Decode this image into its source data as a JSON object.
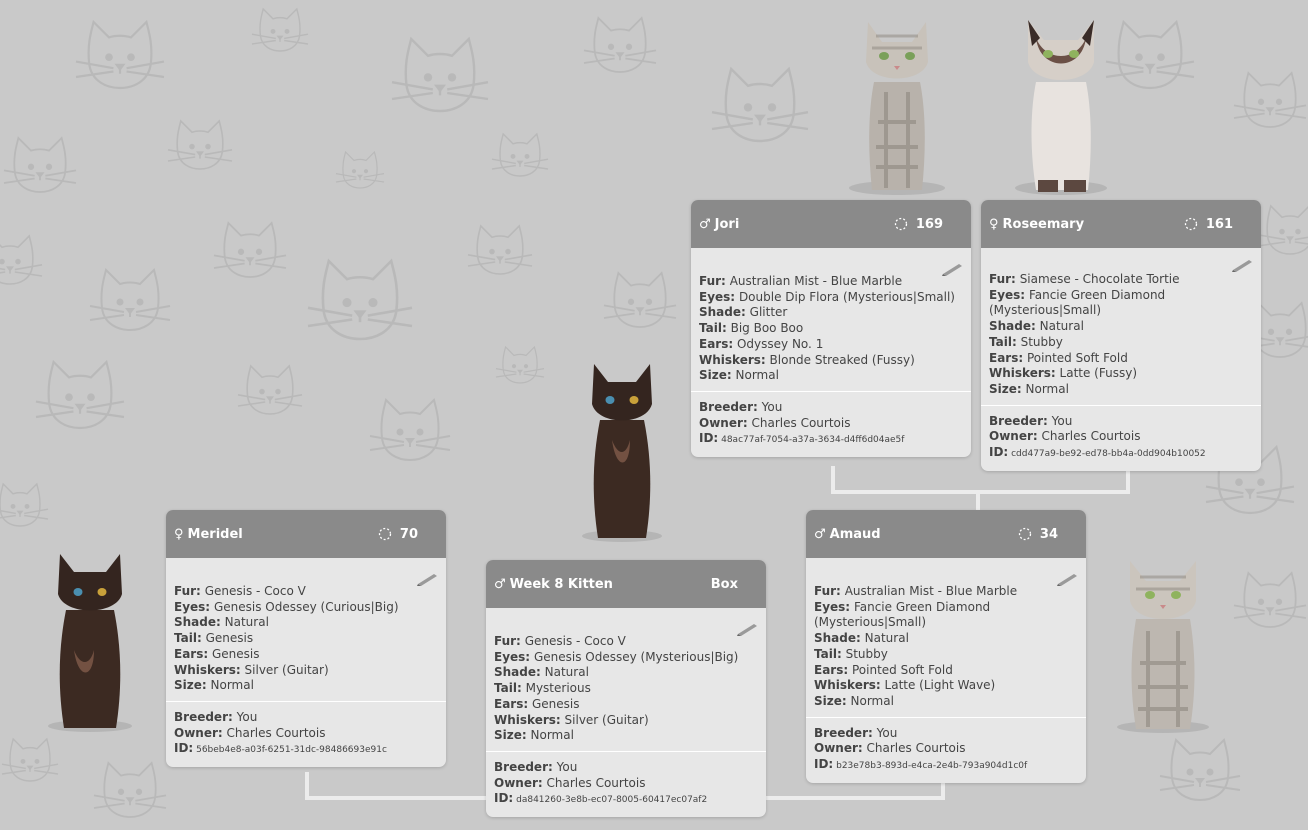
{
  "colors": {
    "background": "#c9c9c9",
    "header": "#8a8a8a",
    "card": "#e7e7e7",
    "connector": "#ececec"
  },
  "icons": {
    "male": "male-symbol-icon",
    "female": "female-symbol-icon",
    "generation": "dashed-circle-icon",
    "edit": "pencil-icon"
  },
  "cards": {
    "jori": {
      "sex": "♂",
      "name": "Jori",
      "generation": "169",
      "fur_label": "Fur:",
      "fur": "Australian Mist - Blue Marble",
      "eyes_label": "Eyes:",
      "eyes": "Double Dip Flora (Mysterious|Small)",
      "shade_label": "Shade:",
      "shade": "Glitter",
      "tail_label": "Tail:",
      "tail": "Big Boo Boo",
      "ears_label": "Ears:",
      "ears": "Odyssey No. 1",
      "whiskers_label": "Whiskers:",
      "whiskers": "Blonde Streaked (Fussy)",
      "size_label": "Size:",
      "size": "Normal",
      "breeder_label": "Breeder:",
      "breeder": "You",
      "owner_label": "Owner:",
      "owner": "Charles Courtois",
      "id_label": "ID:",
      "id": "48ac77af-7054-a37a-3634-d4ff6d04ae5f"
    },
    "roseemary": {
      "sex": "♀",
      "name": "Roseemary",
      "generation": "161",
      "fur_label": "Fur:",
      "fur": "Siamese - Chocolate Tortie",
      "eyes_label": "Eyes:",
      "eyes": "Fancie Green Diamond",
      "eyes_2": "(Mysterious|Small)",
      "shade_label": "Shade:",
      "shade": "Natural",
      "tail_label": "Tail:",
      "tail": "Stubby",
      "ears_label": "Ears:",
      "ears": "Pointed Soft Fold",
      "whiskers_label": "Whiskers:",
      "whiskers": "Latte (Fussy)",
      "size_label": "Size:",
      "size": "Normal",
      "breeder_label": "Breeder:",
      "breeder": "You",
      "owner_label": "Owner:",
      "owner": "Charles Courtois",
      "id_label": "ID:",
      "id": "cdd477a9-be92-ed78-bb4a-0dd904b10052"
    },
    "meridel": {
      "sex": "♀",
      "name": "Meridel",
      "generation": "70",
      "fur_label": "Fur:",
      "fur": "Genesis - Coco V",
      "eyes_label": "Eyes:",
      "eyes": "Genesis Odessey (Curious|Big)",
      "shade_label": "Shade:",
      "shade": "Natural",
      "tail_label": "Tail:",
      "tail": "Genesis",
      "ears_label": "Ears:",
      "ears": "Genesis",
      "whiskers_label": "Whiskers:",
      "whiskers": "Silver (Guitar)",
      "size_label": "Size:",
      "size": "Normal",
      "breeder_label": "Breeder:",
      "breeder": "You",
      "owner_label": "Owner:",
      "owner": "Charles Courtois",
      "id_label": "ID:",
      "id": "56beb4e8-a03f-6251-31dc-98486693e91c"
    },
    "kitten": {
      "sex": "♂",
      "name": "Week 8 Kitten",
      "action": "Box",
      "fur_label": "Fur:",
      "fur": "Genesis - Coco V",
      "eyes_label": "Eyes:",
      "eyes": "Genesis Odessey (Mysterious|Big)",
      "shade_label": "Shade:",
      "shade": "Natural",
      "tail_label": "Tail:",
      "tail": "Mysterious",
      "ears_label": "Ears:",
      "ears": "Genesis",
      "whiskers_label": "Whiskers:",
      "whiskers": "Silver (Guitar)",
      "size_label": "Size:",
      "size": "Normal",
      "breeder_label": "Breeder:",
      "breeder": "You",
      "owner_label": "Owner:",
      "owner": "Charles Courtois",
      "id_label": "ID:",
      "id": "da841260-3e8b-ec07-8005-60417ec07af2"
    },
    "amaud": {
      "sex": "♂",
      "name": "Amaud",
      "generation": "34",
      "fur_label": "Fur:",
      "fur": "Australian Mist - Blue Marble",
      "eyes_label": "Eyes:",
      "eyes": "Fancie Green Diamond",
      "eyes_2": "(Mysterious|Small)",
      "shade_label": "Shade:",
      "shade": "Natural",
      "tail_label": "Tail:",
      "tail": "Stubby",
      "ears_label": "Ears:",
      "ears": "Pointed Soft Fold",
      "whiskers_label": "Whiskers:",
      "whiskers": "Latte (Light Wave)",
      "size_label": "Size:",
      "size": "Normal",
      "breeder_label": "Breeder:",
      "breeder": "You",
      "owner_label": "Owner:",
      "owner": "Charles Courtois",
      "id_label": "ID:",
      "id": "b23e78b3-893d-e4ca-2e4b-793a904d1c0f"
    }
  }
}
